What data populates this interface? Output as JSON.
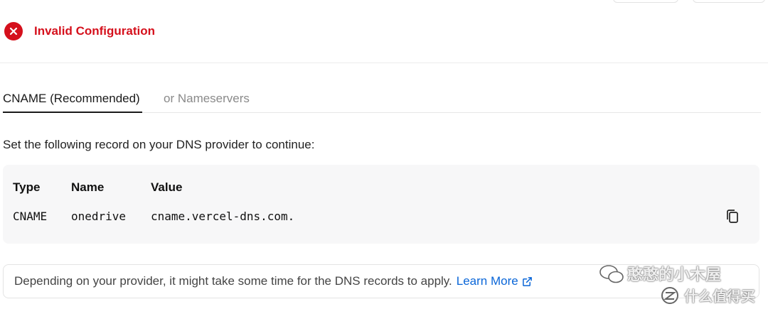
{
  "status": {
    "text": "Invalid Configuration",
    "color": "#d5101c",
    "icon": "error-x-icon"
  },
  "tabs": [
    {
      "label": "CNAME (Recommended)",
      "active": true
    },
    {
      "label": "or Nameservers",
      "active": false
    }
  ],
  "instructions": "Set the following record on your DNS provider to continue:",
  "record": {
    "headers": {
      "type": "Type",
      "name": "Name",
      "value": "Value"
    },
    "row": {
      "type": "CNAME",
      "name": "onedrive",
      "value": "cname.vercel-dns.com."
    },
    "copy_icon": "copy-icon"
  },
  "notice": {
    "text": "Depending on your provider, it might take some time for the DNS records to apply.",
    "link_label": "Learn More",
    "link_icon": "external-link-icon",
    "link_color": "#0a66d8"
  },
  "watermark": {
    "line1": "憨憨的小木屋",
    "line2": "什么值得买"
  }
}
